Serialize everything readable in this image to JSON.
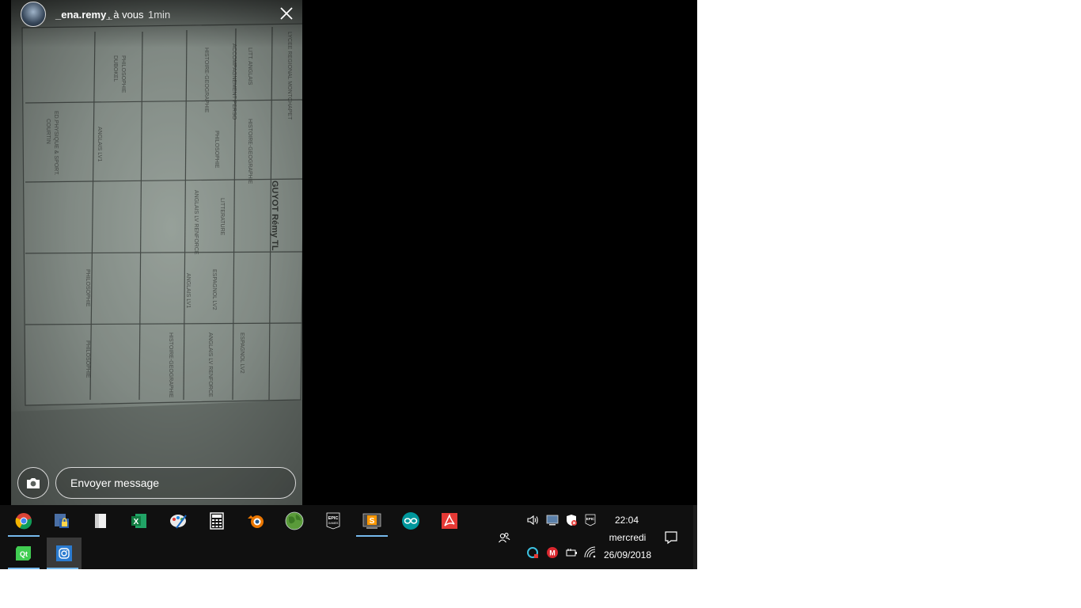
{
  "story": {
    "username": "_ena.remy_",
    "audience": ", à vous",
    "time": "1min",
    "photo_title": "GUYOT Rémy TL",
    "reply_placeholder": "Envoyer message"
  },
  "taskbar": {
    "apps": [
      {
        "name": "Google Chrome",
        "icon": "chrome-icon"
      },
      {
        "name": "Security App",
        "icon": "lock-icon"
      },
      {
        "name": "Document",
        "icon": "document-icon"
      },
      {
        "name": "Microsoft Excel",
        "icon": "excel-icon",
        "label": "X"
      },
      {
        "name": "Paint",
        "icon": "paint-icon"
      },
      {
        "name": "Calculator",
        "icon": "calculator-icon"
      },
      {
        "name": "Blender",
        "icon": "blender-icon"
      },
      {
        "name": "Earth",
        "icon": "globe-icon"
      },
      {
        "name": "Epic Games",
        "icon": "epic-icon",
        "label": "EPIC"
      },
      {
        "name": "Sublime Text",
        "icon": "sublime-icon",
        "label": "S"
      },
      {
        "name": "Arduino",
        "icon": "arduino-icon"
      },
      {
        "name": "PDF Reader",
        "icon": "pdf-icon"
      },
      {
        "name": "Qt",
        "icon": "qt-icon",
        "label": "Qt"
      },
      {
        "name": "Instagram",
        "icon": "instagram-icon"
      }
    ],
    "clock": {
      "time": "22:04",
      "day": "mercredi",
      "date": "26/09/2018"
    },
    "tray": {
      "epic_label": "EPIC",
      "mega_label": "M"
    }
  },
  "colors": {
    "taskbar_bg": "#101010",
    "active_indicator": "#76b9ed",
    "window_bg": "#000000"
  }
}
